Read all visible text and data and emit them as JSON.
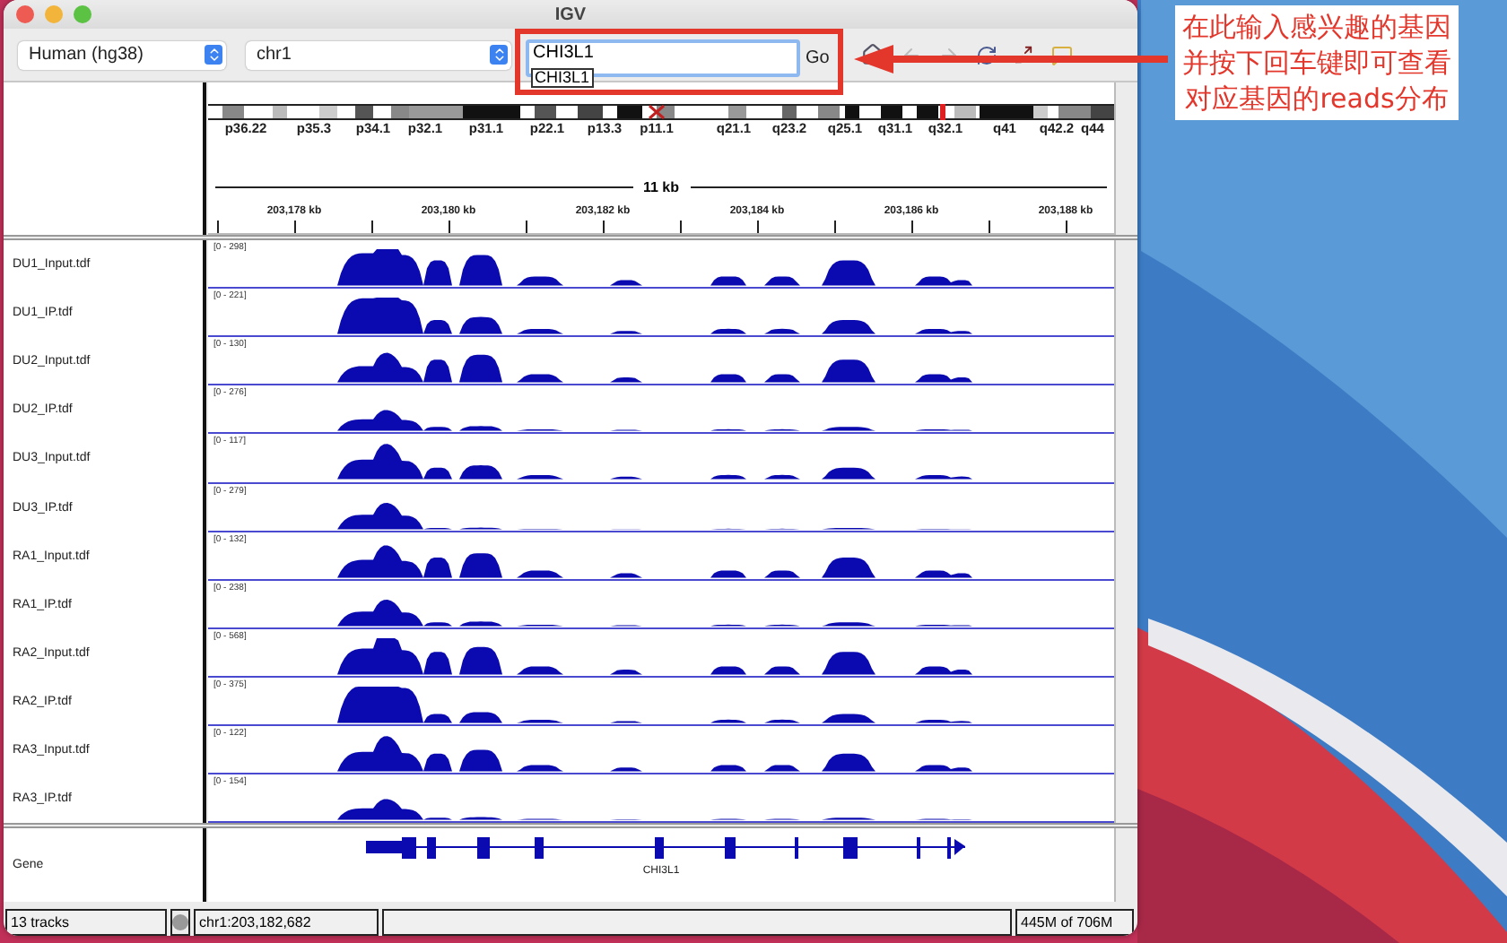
{
  "window": {
    "title": "IGV"
  },
  "toolbar": {
    "genome": "Human (hg38)",
    "chromosome": "chr1",
    "locus": {
      "value": "CHI3L1"
    },
    "suggestion": "CHI3L1",
    "go": "Go"
  },
  "ideogram": {
    "bands": [
      "p36.22",
      "p35.3",
      "p34.1",
      "p32.1",
      "p31.1",
      "p22.1",
      "p13.3",
      "p11.1",
      "q21.1",
      "q23.2",
      "q25.1",
      "q31.1",
      "q32.1",
      "q41",
      "q42.2",
      "q44"
    ]
  },
  "ruler": {
    "span": "11 kb",
    "ticks": [
      "203,178 kb",
      "203,180 kb",
      "203,182 kb",
      "203,184 kb",
      "203,186 kb",
      "203,188 kb"
    ]
  },
  "tracks": [
    {
      "name": "DU1_Input.tdf",
      "range": "[0 - 298]"
    },
    {
      "name": "DU1_IP.tdf",
      "range": "[0 - 221]"
    },
    {
      "name": "DU2_Input.tdf",
      "range": "[0 - 130]"
    },
    {
      "name": "DU2_IP.tdf",
      "range": "[0 - 276]"
    },
    {
      "name": "DU3_Input.tdf",
      "range": "[0 - 117]"
    },
    {
      "name": "DU3_IP.tdf",
      "range": "[0 - 279]"
    },
    {
      "name": "RA1_Input.tdf",
      "range": "[0 - 132]"
    },
    {
      "name": "RA1_IP.tdf",
      "range": "[0 - 238]"
    },
    {
      "name": "RA2_Input.tdf",
      "range": "[0 - 568]"
    },
    {
      "name": "RA2_IP.tdf",
      "range": "[0 - 375]"
    },
    {
      "name": "RA3_Input.tdf",
      "range": "[0 - 122]"
    },
    {
      "name": "RA3_IP.tdf",
      "range": "[0 - 154]"
    }
  ],
  "gene_track": {
    "name": "Gene",
    "gene": "CHI3L1"
  },
  "status_bar": {
    "tracks": "13 tracks",
    "position": "chr1:203,182,682",
    "memory": "445M of 706M"
  },
  "annotation": {
    "lines": [
      "在此输入感兴趣的基因",
      "并按下回车键即可查看",
      "对应基因的reads分布"
    ]
  }
}
